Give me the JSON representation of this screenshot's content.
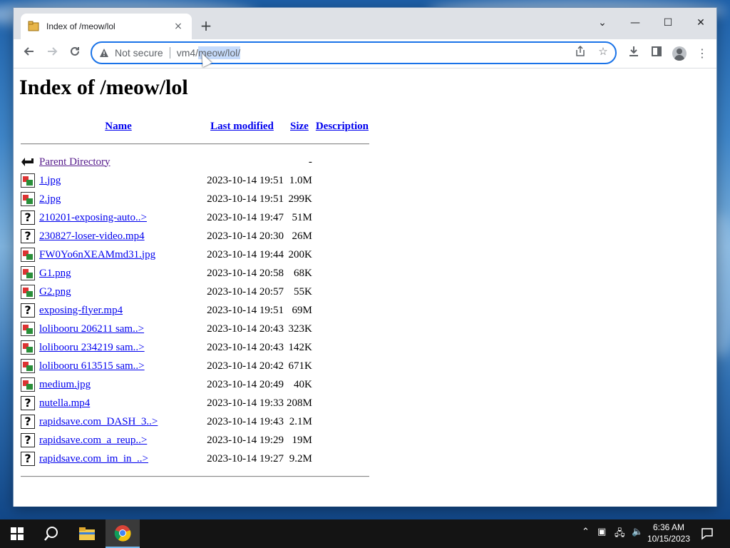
{
  "browser": {
    "tab_title": "Index of /meow/lol",
    "tab_close": "×",
    "new_tab": "+",
    "not_secure": "Not secure",
    "url_host": "vm4/",
    "url_path": "meow/lol/",
    "window_controls": {
      "dropdown": "⌄",
      "minimize": "—",
      "maximize": "☐",
      "close": "✕"
    }
  },
  "page": {
    "heading": "Index of /meow/lol",
    "columns": {
      "name": "Name",
      "last_modified": "Last modified",
      "size": "Size",
      "description": "Description"
    },
    "parent": {
      "label": "Parent Directory",
      "size": "-"
    },
    "files": [
      {
        "name": "1.jpg",
        "modified": "2023-10-14 19:51",
        "size": "1.0M",
        "type": "image"
      },
      {
        "name": "2.jpg",
        "modified": "2023-10-14 19:51",
        "size": "299K",
        "type": "image"
      },
      {
        "name": "210201-exposing-auto..>",
        "modified": "2023-10-14 19:47",
        "size": "51M",
        "type": "unknown"
      },
      {
        "name": "230827-loser-video.mp4",
        "modified": "2023-10-14 20:30",
        "size": "26M",
        "type": "unknown"
      },
      {
        "name": "FW0Yo6nXEAMmd31.jpg",
        "modified": "2023-10-14 19:44",
        "size": "200K",
        "type": "image"
      },
      {
        "name": "G1.png",
        "modified": "2023-10-14 20:58",
        "size": "68K",
        "type": "image"
      },
      {
        "name": "G2.png",
        "modified": "2023-10-14 20:57",
        "size": "55K",
        "type": "image"
      },
      {
        "name": "exposing-flyer.mp4",
        "modified": "2023-10-14 19:51",
        "size": "69M",
        "type": "unknown"
      },
      {
        "name": "lolibooru 206211 sam..>",
        "modified": "2023-10-14 20:43",
        "size": "323K",
        "type": "image"
      },
      {
        "name": "lolibooru 234219 sam..>",
        "modified": "2023-10-14 20:43",
        "size": "142K",
        "type": "image"
      },
      {
        "name": "lolibooru 613515 sam..>",
        "modified": "2023-10-14 20:42",
        "size": "671K",
        "type": "image"
      },
      {
        "name": "medium.jpg",
        "modified": "2023-10-14 20:49",
        "size": "40K",
        "type": "image"
      },
      {
        "name": "nutella.mp4",
        "modified": "2023-10-14 19:33",
        "size": "208M",
        "type": "unknown"
      },
      {
        "name": "rapidsave.com_DASH_3..>",
        "modified": "2023-10-14 19:43",
        "size": "2.1M",
        "type": "unknown"
      },
      {
        "name": "rapidsave.com_a_reup..>",
        "modified": "2023-10-14 19:29",
        "size": "19M",
        "type": "unknown"
      },
      {
        "name": "rapidsave.com_im_in_..>",
        "modified": "2023-10-14 19:27",
        "size": "9.2M",
        "type": "unknown"
      }
    ]
  },
  "taskbar": {
    "time": "6:36 AM",
    "date": "10/15/2023"
  },
  "colors": {
    "link": "#0000ee",
    "visited_link": "#551a8b",
    "omnibox_focus": "#1a73e8",
    "taskbar": "#141414"
  }
}
